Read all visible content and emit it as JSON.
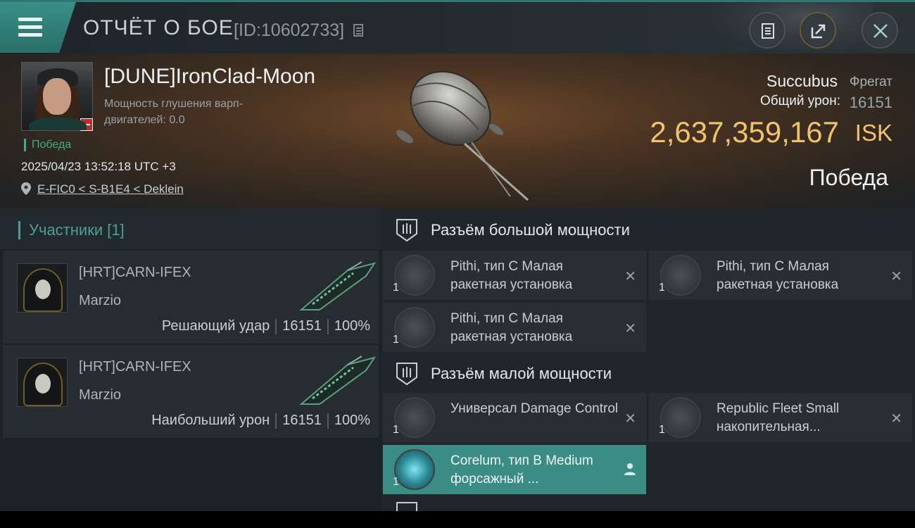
{
  "header": {
    "title": "ОТЧЁТ О БОЕ",
    "report_id": "[ID:10602733]",
    "menu_icon": "hamburger-menu-icon",
    "buttons": {
      "log": "log-icon",
      "share": "share-icon",
      "close": "close-icon"
    }
  },
  "victim": {
    "pilot_name": "[DUNE]IronClad-Moon",
    "warp_scram_label": "Мощность глушения варп-двигателей: 0.0",
    "status": "Победа",
    "datetime": "2025/04/23 13:52:18 UTC +3",
    "location": "E-FIC0 < S-B1E4 < Deklein",
    "ship_name": "Succubus",
    "ship_class": "Фрегат",
    "total_damage_label": "Общий урон:",
    "total_damage": "16151",
    "isk_value": "2,637,359,167",
    "isk_unit": "ISK",
    "result": "Победа"
  },
  "participants": {
    "title": "Участники [1]",
    "rows": [
      {
        "corp": "[HRT]CARN-IFEX",
        "name": "Marzio",
        "role": "Решающий удар",
        "damage": "16151",
        "percent": "100%"
      },
      {
        "corp": "[HRT]CARN-IFEX",
        "name": "Marzio",
        "role": "Наибольший урон",
        "damage": "16151",
        "percent": "100%"
      }
    ]
  },
  "fittings": {
    "high_slot_title": "Разъём большой мощности",
    "low_slot_title": "Разъём малой мощности",
    "high": [
      {
        "name": "Pithi, тип C Малая ракетная установка",
        "qty": "1"
      },
      {
        "name": "Pithi, тип C Малая ракетная установка",
        "qty": "1"
      },
      {
        "name": "Pithi, тип C Малая ракетная установка",
        "qty": "1"
      }
    ],
    "low": [
      {
        "name": "Универсал Damage Control",
        "qty": "1"
      },
      {
        "name": "Republic Fleet Small накопительная...",
        "qty": "1"
      },
      {
        "name": "Corelum, тип B Medium форсажный ...",
        "qty": "1"
      }
    ]
  },
  "colors": {
    "accent": "#3c8c86",
    "isk": "#f0c36c",
    "victory": "#3fae88"
  }
}
